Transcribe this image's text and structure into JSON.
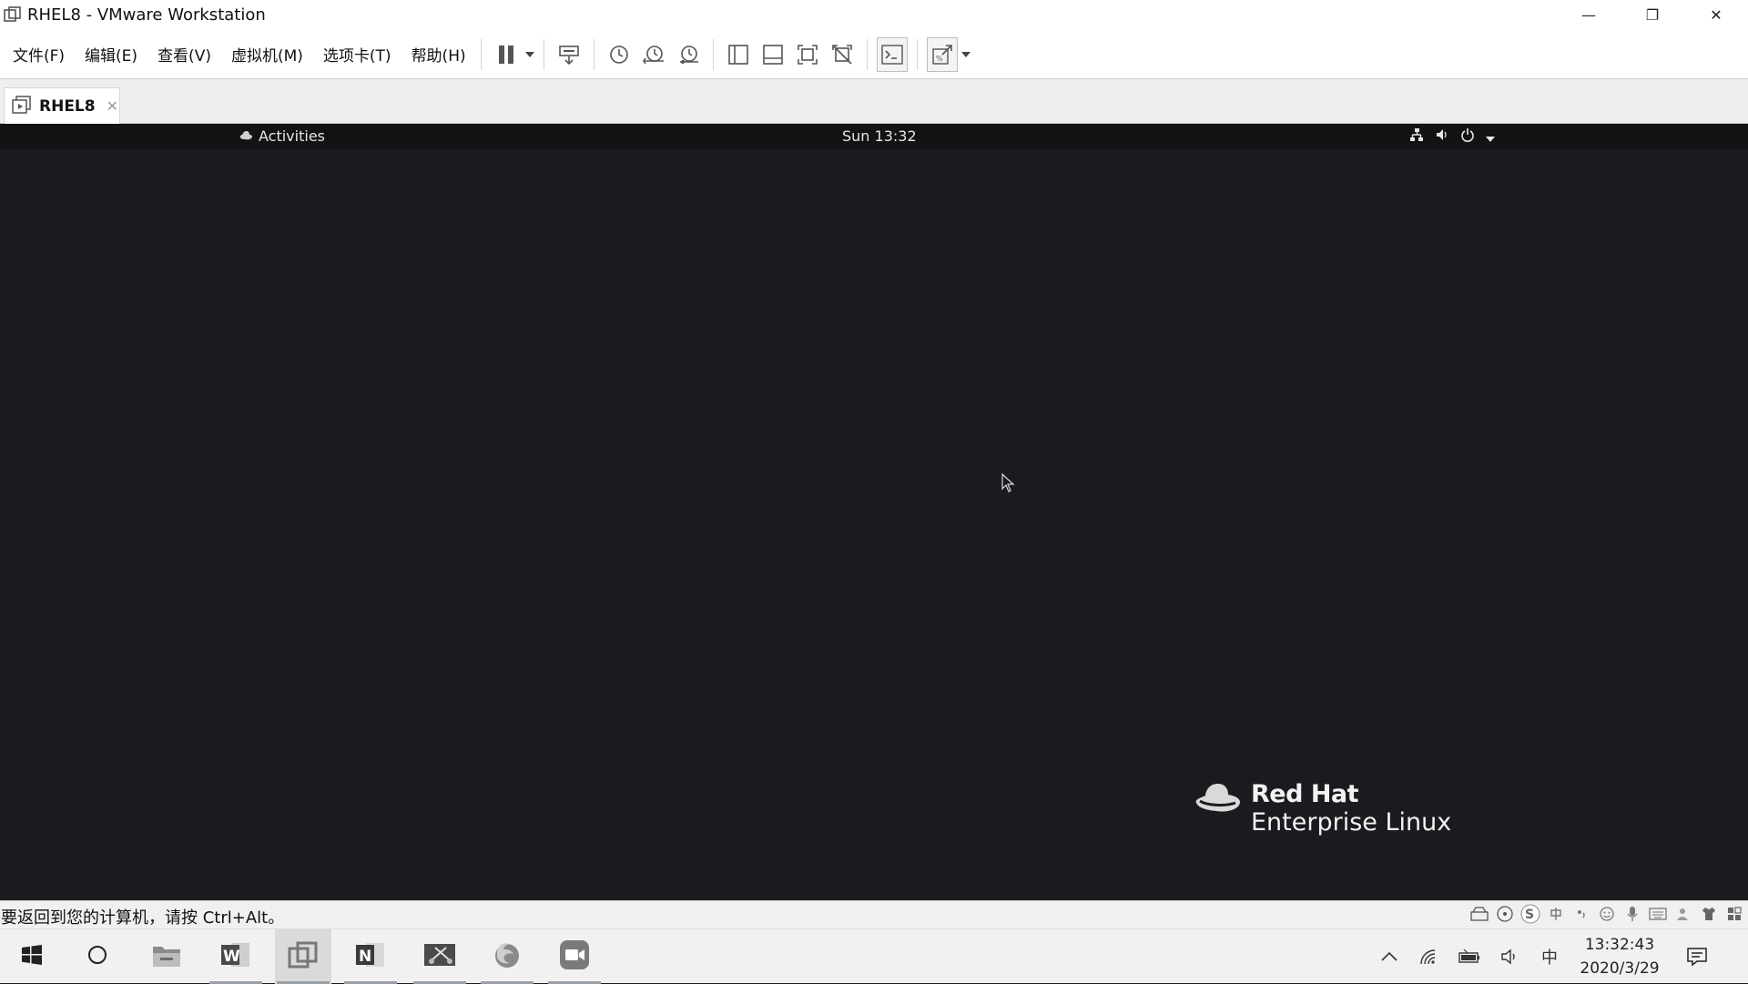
{
  "window": {
    "title": "RHEL8 - VMware Workstation",
    "controls": {
      "minimize": "—",
      "restore": "❐",
      "close": "✕"
    }
  },
  "menu": {
    "items": [
      "文件(F)",
      "编辑(E)",
      "查看(V)",
      "虚拟机(M)",
      "选项卡(T)",
      "帮助(H)"
    ]
  },
  "toolbar": {
    "icons": [
      "pause-icon",
      "send-keys-icon",
      "snapshot-icon",
      "revert-snapshot-icon",
      "snapshot-manager-icon",
      "library-icon",
      "thumbnail-bar-icon",
      "full-screen-icon",
      "unity-icon",
      "console-icon",
      "stretch-icon"
    ]
  },
  "tab": {
    "label": "RHEL8",
    "close": "✕"
  },
  "guest": {
    "activities": "Activities",
    "clock": "Sun 13:32",
    "brand_line1": "Red Hat",
    "brand_line2": "Enterprise Linux"
  },
  "statusbar": {
    "hint": "要返回到您的计算机，请按 Ctrl+Alt。"
  },
  "taskbar": {
    "apps": [
      "start-button",
      "search-button",
      "file-explorer",
      "word",
      "vmware-workstation",
      "onenote",
      "snipping-tool",
      "firefox",
      "zoom"
    ],
    "ime": "中",
    "time": "13:32:43",
    "date": "2020/3/29"
  },
  "colors": {
    "guest_bg": "#1b1a1e",
    "gnome_bar": "#131215",
    "taskbar_bg": "#f1f1f1"
  }
}
